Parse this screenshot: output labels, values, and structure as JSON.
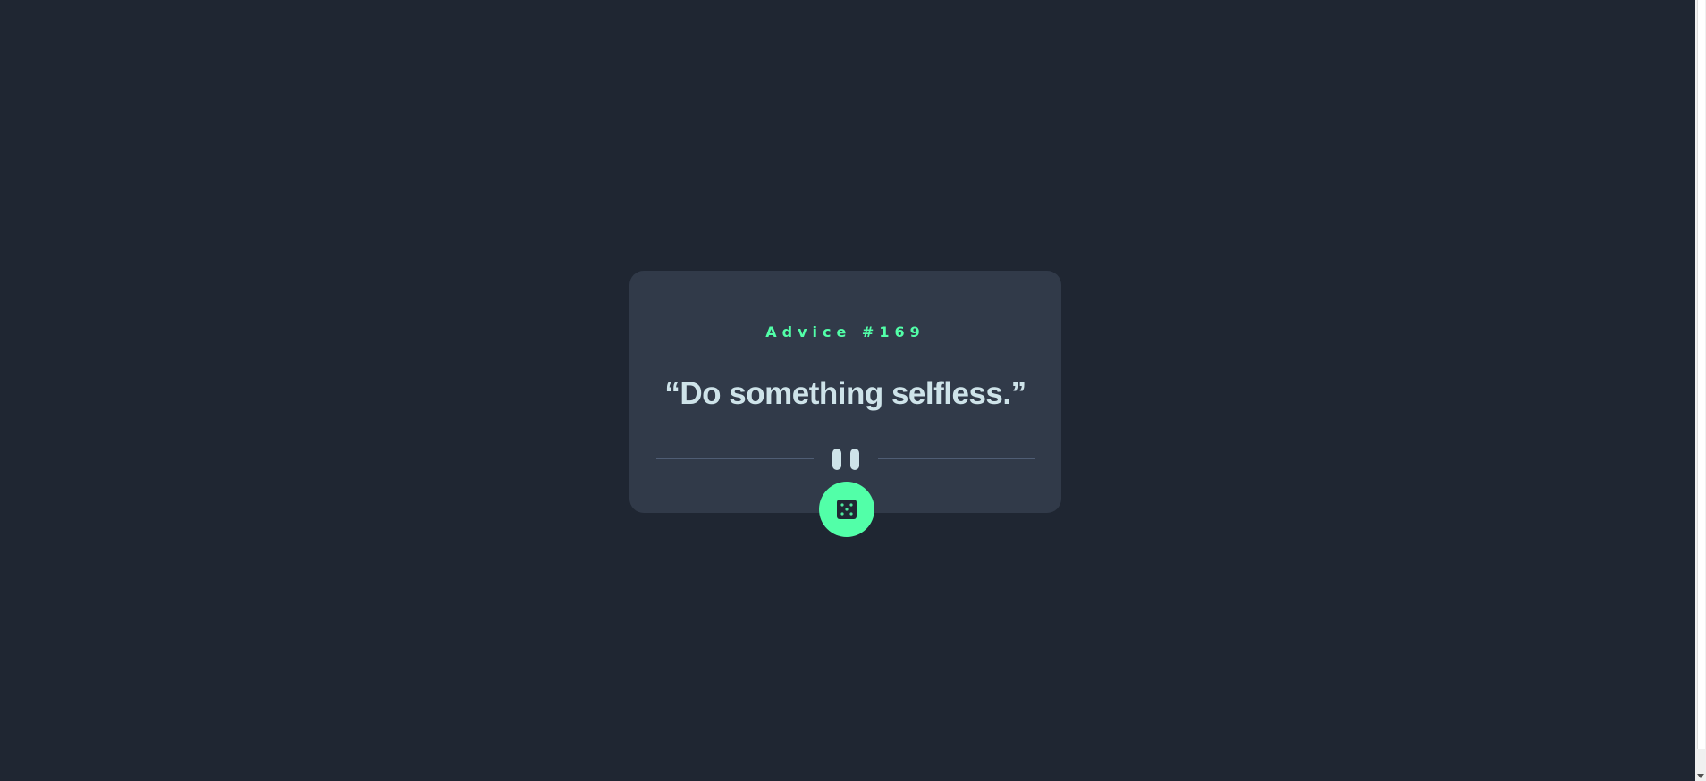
{
  "advice": {
    "label": "Advice #169",
    "quote": "“Do something selfless.”"
  },
  "icons": {
    "divider": "pause-icon",
    "button": "dice-icon"
  },
  "colors": {
    "background": "#1f2632",
    "card": "#313a49",
    "accent": "#52ffa8",
    "text": "#cee3e9",
    "divider": "#4f5d74"
  }
}
